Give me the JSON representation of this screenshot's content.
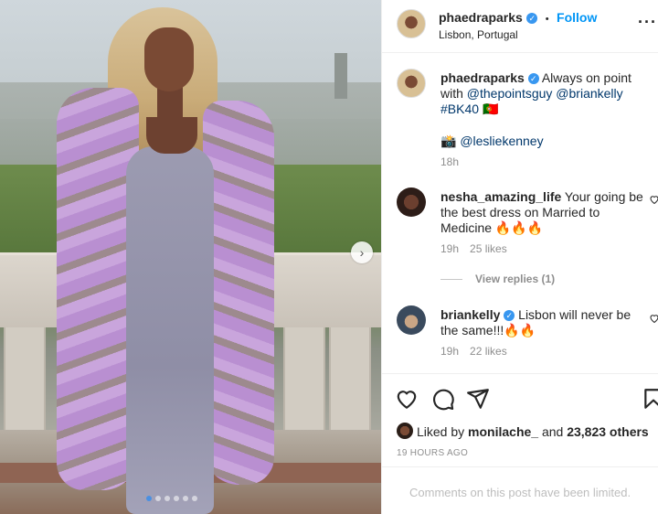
{
  "post": {
    "carousel": {
      "next_glyph": "›",
      "slide_count": 6,
      "active_index": 0
    }
  },
  "header": {
    "username": "phaedraparks",
    "verified_glyph": "✓",
    "separator": "•",
    "follow_label": "Follow",
    "location": "Lisbon, Portugal",
    "more_glyph": "···"
  },
  "caption": {
    "username": "phaedraparks",
    "text_part1": "Always on point with",
    "mention1": "@thepointsguy",
    "mention2": "@briankelly",
    "hashtag": "#BK40",
    "flag": "🇵🇹",
    "credit_emoji": "📸",
    "credit_mention": "@lesliekenney",
    "time": "18h"
  },
  "comments": [
    {
      "username": "nesha_amazing_life",
      "text": "Your going be the best dress on Married to Medicine 🔥🔥🔥",
      "time": "19h",
      "likes": "25 likes",
      "view_replies": "View replies (1)"
    },
    {
      "username": "briankelly",
      "text": "Lisbon will never be the same!!!🔥🔥",
      "time": "19h",
      "likes": "22 likes"
    }
  ],
  "actions": {
    "liked_prefix": "Liked by",
    "liked_user": "monilache_",
    "liked_and": "and",
    "liked_count": "23,823 others",
    "timestamp": "19 HOURS AGO"
  },
  "footer": {
    "limited_text": "Comments on this post have been limited."
  },
  "icons": {
    "like": "heart-icon",
    "comment": "comment-icon",
    "share": "paper-plane-icon",
    "save": "bookmark-icon"
  },
  "colors": {
    "link_blue": "#0095f6",
    "verified_blue": "#3897f0",
    "mention": "#00376b"
  }
}
